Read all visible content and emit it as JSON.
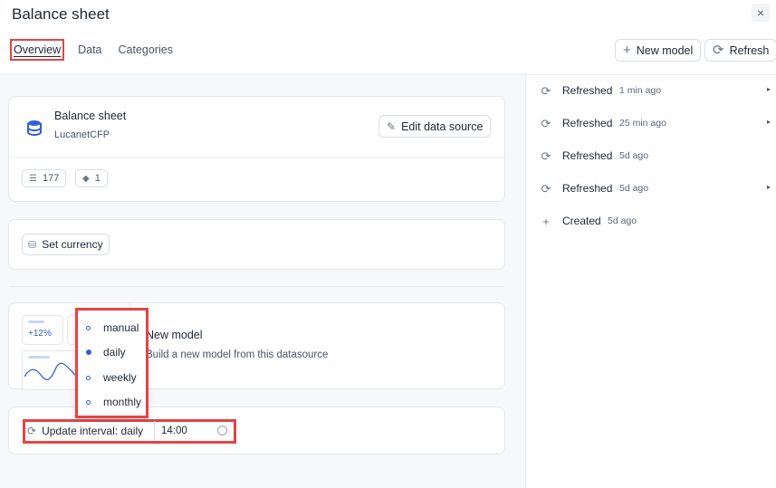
{
  "header": {
    "title": "Balance sheet",
    "close_label": "×",
    "tabs": [
      {
        "label": "Overview",
        "active": true
      },
      {
        "label": "Data",
        "active": false
      },
      {
        "label": "Categories",
        "active": false
      }
    ],
    "new_model_label": "New model",
    "refresh_label": "Refresh"
  },
  "datasource": {
    "title": "Balance sheet",
    "subtitle": "LucanetCFP",
    "edit_label": "Edit data source",
    "chips": [
      {
        "icon": "database-icon",
        "value": "177"
      },
      {
        "icon": "cube-icon",
        "value": "1"
      }
    ]
  },
  "currency": {
    "label": "Set currency"
  },
  "new_model_card": {
    "title": "New model",
    "subtitle": "Build a new model from this datasource",
    "badge": "+12%"
  },
  "update": {
    "label": "Update interval: daily",
    "time": "14:00",
    "options": [
      {
        "label": "manual",
        "selected": false
      },
      {
        "label": "daily",
        "selected": true
      },
      {
        "label": "weekly",
        "selected": false
      },
      {
        "label": "monthly",
        "selected": false
      }
    ]
  },
  "history": [
    {
      "label": "Refreshed",
      "time": "1 min ago",
      "icon": "refresh-icon",
      "chevron": true
    },
    {
      "label": "Refreshed",
      "time": "25 min ago",
      "icon": "refresh-icon",
      "chevron": true
    },
    {
      "label": "Refreshed",
      "time": "5d ago",
      "icon": "refresh-icon",
      "chevron": false
    },
    {
      "label": "Refreshed",
      "time": "5d ago",
      "icon": "refresh-icon",
      "chevron": true
    },
    {
      "label": "Created",
      "time": "5d ago",
      "icon": "plus-icon",
      "chevron": false
    }
  ],
  "colors": {
    "accent": "#2f5fd6",
    "highlight": "#e34446",
    "panel_bg": "#f7f8fa"
  }
}
